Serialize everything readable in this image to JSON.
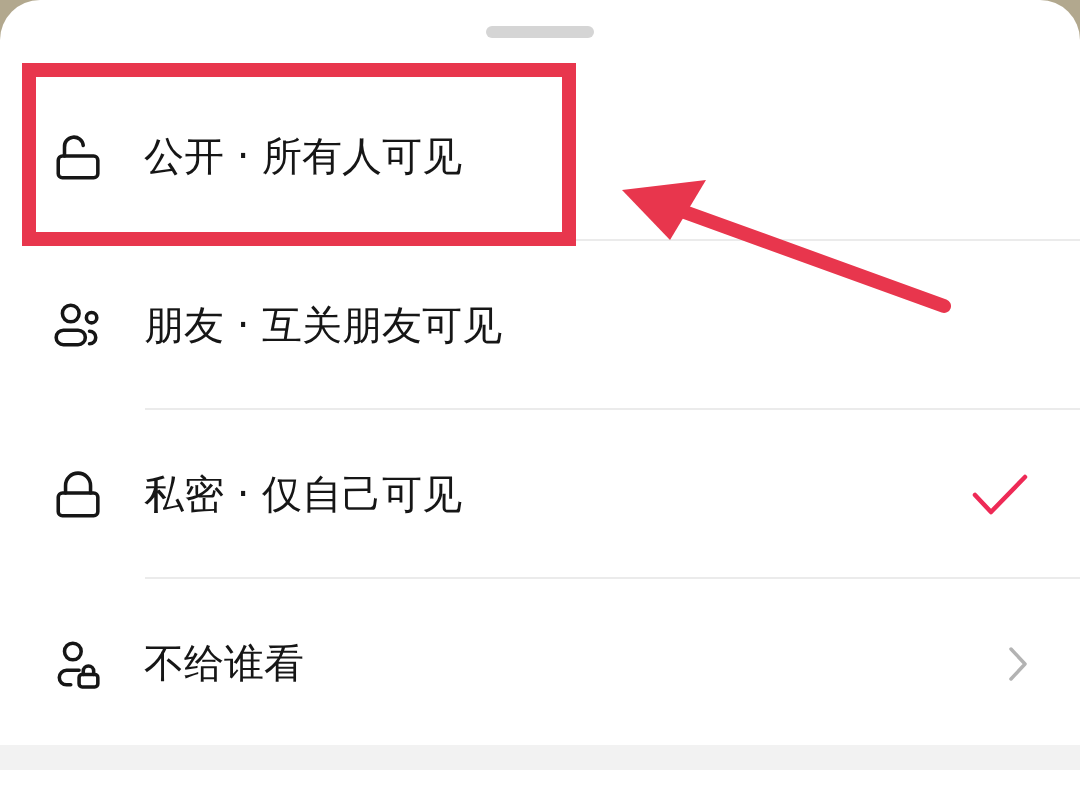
{
  "options": [
    {
      "kind": "option",
      "label": "公开 · 所有人可见",
      "selected": false,
      "highlighted": true
    },
    {
      "kind": "option",
      "label": "朋友 · 互关朋友可见",
      "selected": false,
      "highlighted": false
    },
    {
      "kind": "option",
      "label": "私密 · 仅自己可见",
      "selected": true,
      "highlighted": false
    },
    {
      "kind": "submenu",
      "label": "不给谁看",
      "highlighted": false
    }
  ]
}
